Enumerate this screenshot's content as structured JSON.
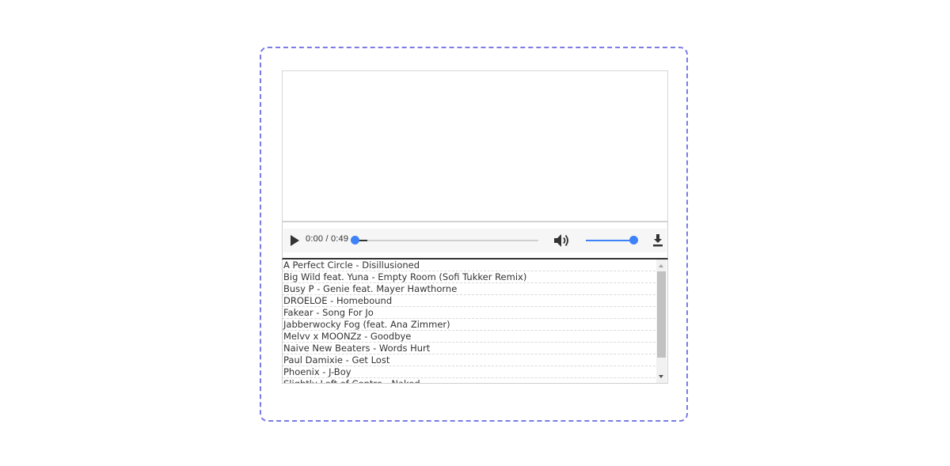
{
  "player": {
    "time_display": "0:00 / 0:49",
    "progress": 0.07,
    "volume": 1.0,
    "colors": {
      "accent": "#3e82f7",
      "frame_border": "#7b7be6",
      "text": "#333333"
    },
    "icons": {
      "play": "play-icon",
      "volume": "volume-icon",
      "download": "download-icon"
    }
  },
  "playlist": {
    "tracks": [
      "A Perfect Circle - Disillusioned",
      "Big Wild feat. Yuna - Empty Room (Sofi Tukker Remix)",
      "Busy P - Genie feat. Mayer Hawthorne",
      "DROELOE - Homebound",
      "Fakear - Song For Jo",
      "Jabberwocky Fog (feat. Ana Zimmer)",
      "Melvv x MOONZz - Goodbye",
      "Naive New Beaters - Words Hurt",
      "Paul Damixie - Get Lost",
      "Phoenix - J-Boy",
      "Slightly Left of Centre - Naked"
    ]
  }
}
